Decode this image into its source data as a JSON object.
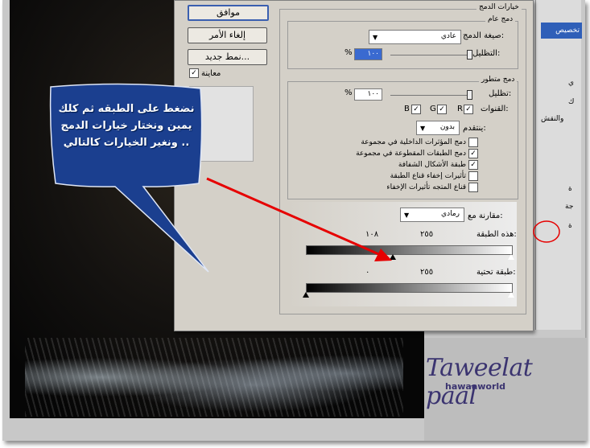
{
  "dialog": {
    "buttons": {
      "ok": "موافق",
      "cancel": "إلغاء الأمر",
      "new_style": "نمط جديد..."
    },
    "preview_label": "معاينة",
    "blending_options_title": "خيارات الدمج",
    "general_blending": {
      "title": "دمج عام",
      "blend_mode_label": "صيغة الدمج:",
      "blend_mode_value": "عادي",
      "opacity_label": "التظليل:",
      "opacity_value": "١٠٠",
      "percent": "%"
    },
    "advanced_blending": {
      "title": "دمج متطور",
      "fill_opacity_label": "تظليل:",
      "fill_opacity_value": "١٠٠",
      "percent": "%",
      "channels_label": "القنوات:",
      "channels": [
        "R",
        "G",
        "B"
      ],
      "knockout_label": "ينتقدم:",
      "knockout_value": "بدون",
      "options": [
        {
          "label": "دمج المؤثرات الداخلية في مجموعة",
          "checked": false
        },
        {
          "label": "دمج الطبقات المقطوعة في مجموعة",
          "checked": true
        },
        {
          "label": "طبقة الأشكال الشفافة",
          "checked": true
        },
        {
          "label": "تأثيرات إخفاء قناع الطبقة",
          "checked": false
        },
        {
          "label": "قناع المتجه تأثيرات الإخفاء",
          "checked": false
        }
      ]
    },
    "blend_if": {
      "label": "مقارنة مع:",
      "value": "رمادي",
      "this_layer_label": "هذه الطبقة:",
      "this_layer_black": "١٠٨",
      "this_layer_white": "٢٥٥",
      "this_layer_black_level": 108,
      "underlying_layer_label": "طبقة تحتية:",
      "underlying_black": "٠",
      "underlying_white": "٢٥٥"
    }
  },
  "styles_panel": {
    "selected_item": "تخصيص",
    "items": [
      "ي",
      "ك",
      "والنقش",
      "ة",
      "جة",
      "ة"
    ]
  },
  "callout": {
    "text_line1": "نضغط على الطبقه ثم كلك",
    "text_line2": "يمين ونختار خيارات الدمج",
    "text_line3": "ونغير الخيارات كالتالي .."
  },
  "watermark": {
    "title": "Taweelat paal",
    "subtitle": "hawaaworld"
  },
  "colors": {
    "callout_fill": "#1b3f8f",
    "arrow": "#e60000",
    "selection": "#2f5fb8",
    "watermark": "#3b3470"
  }
}
